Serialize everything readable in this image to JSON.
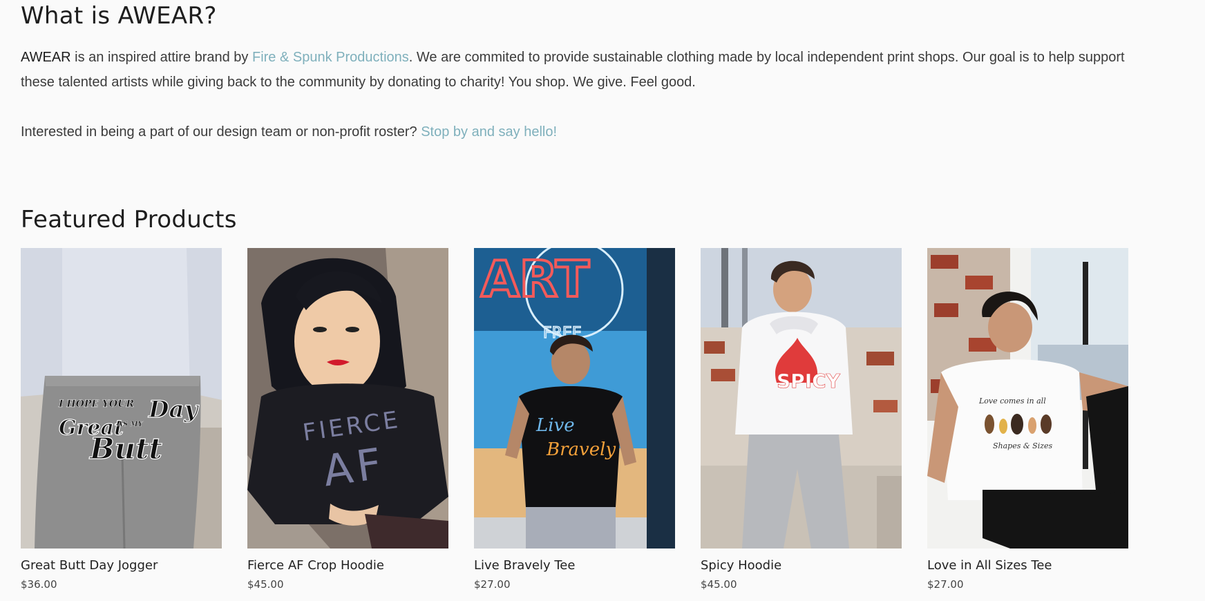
{
  "about": {
    "title": "What is AWEAR?",
    "brand": "AWEAR",
    "text_a": " is an inspired attire brand by ",
    "link_producer": "Fire & Spunk Productions",
    "text_b": ". We are commited to provide sustainable clothing made by local independent print shops. Our goal is to help support these talented artists while giving back to the community by donating to charity! You shop. We give. Feel good.",
    "join_text": "Interested in being a part of our design team or non-profit roster? ",
    "join_link": "Stop by and say hello!"
  },
  "featured": {
    "title": "Featured Products",
    "products": [
      {
        "name": "Great Butt Day Jogger",
        "price": "$36.00",
        "print": "I HOPE YOUR Day IS AS Great AS MY Butt"
      },
      {
        "name": "Fierce AF Crop Hoodie",
        "price": "$45.00",
        "print": "FIERCE AF"
      },
      {
        "name": "Live Bravely Tee",
        "price": "$27.00",
        "print": "Live Bravely",
        "sign": "ART",
        "sign_sub": "FREE"
      },
      {
        "name": "Spicy Hoodie",
        "price": "$45.00",
        "print": "SPICY"
      },
      {
        "name": "Love in All Sizes Tee",
        "price": "$27.00",
        "print": "Love comes in all Shapes & Sizes"
      }
    ]
  },
  "colors": {
    "background": "#fafafa",
    "link": "#7fb0bc",
    "heading": "#1e1e1e"
  }
}
